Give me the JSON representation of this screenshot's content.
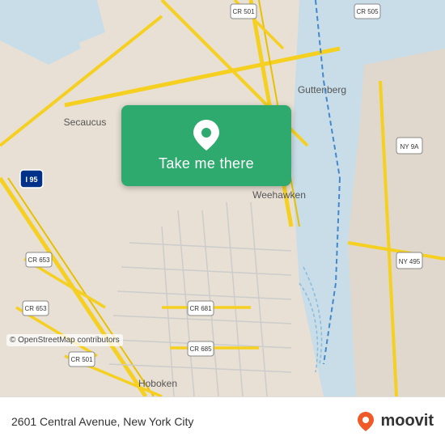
{
  "map": {
    "background_color": "#e8e0d8",
    "osm_credit": "© OpenStreetMap contributors"
  },
  "button": {
    "label": "Take me there",
    "background_color": "#2eaa6e",
    "icon": "location-pin"
  },
  "bottom_bar": {
    "address": "2601 Central Avenue, New York City",
    "moovit_brand": "moovit"
  }
}
